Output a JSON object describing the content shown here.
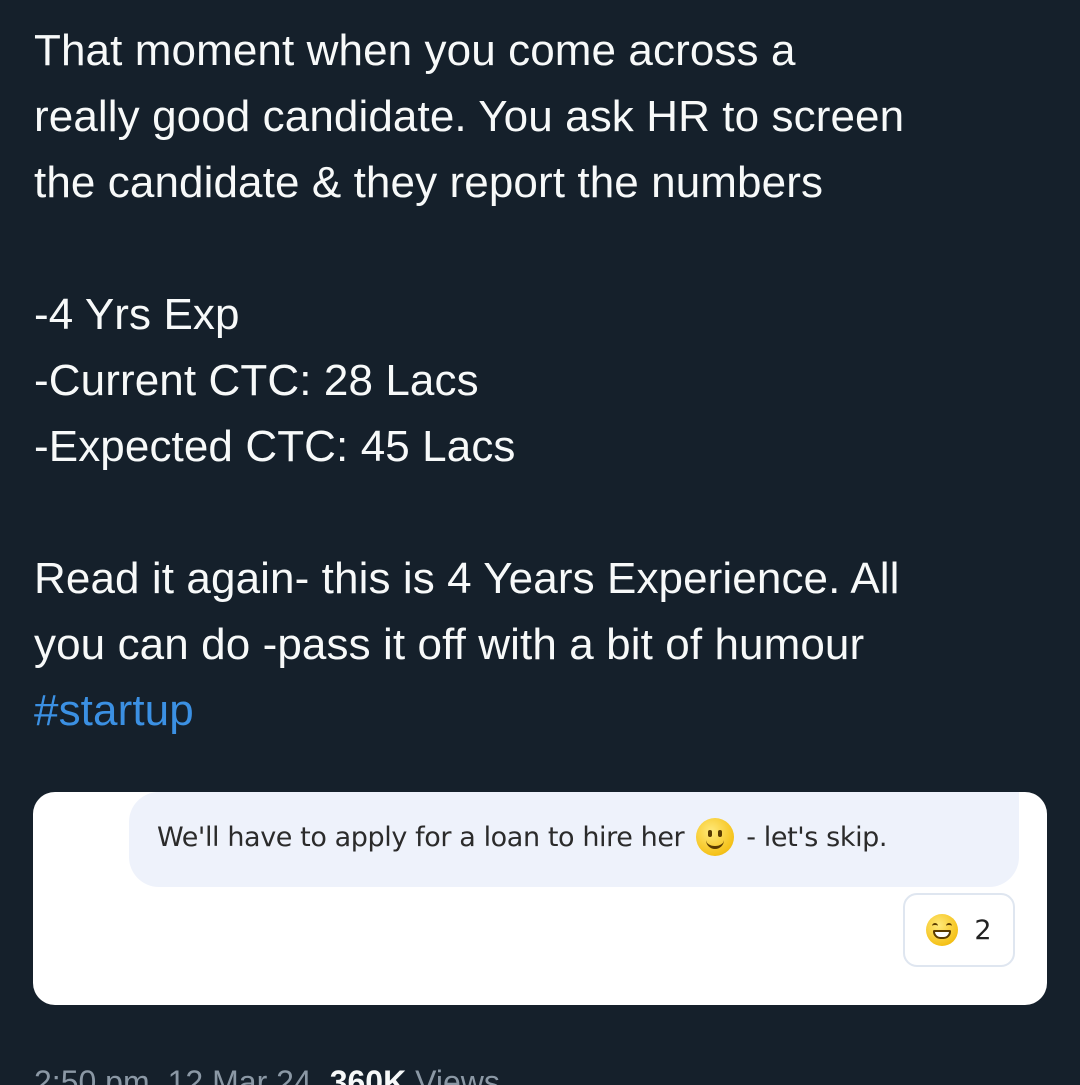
{
  "tweet": {
    "lines_para1": [
      "That moment when you come across a",
      "really good candidate. You ask HR to screen",
      "the candidate & they report the numbers"
    ],
    "lines_para2": [
      "-4 Yrs Exp",
      "-Current CTC: 28 Lacs",
      "-Expected CTC: 45 Lacs"
    ],
    "lines_para3": [
      "Read it again- this is 4 Years Experience. All",
      "you can do -pass it off with a bit of humour"
    ],
    "hashtag": "#startup"
  },
  "media": {
    "message_before_emoji": "We'll have to apply for a loan to hire her",
    "message_after_emoji": "- let's skip.",
    "reaction_count": "2"
  },
  "meta": {
    "time": "2:50 pm",
    "date": "12 Mar 24",
    "views_count": "360K",
    "views_label": "Views"
  },
  "colors": {
    "background": "#15202b",
    "text": "#f7f9f9",
    "hashtag": "#3b90e3",
    "muted": "#8b98a5"
  }
}
